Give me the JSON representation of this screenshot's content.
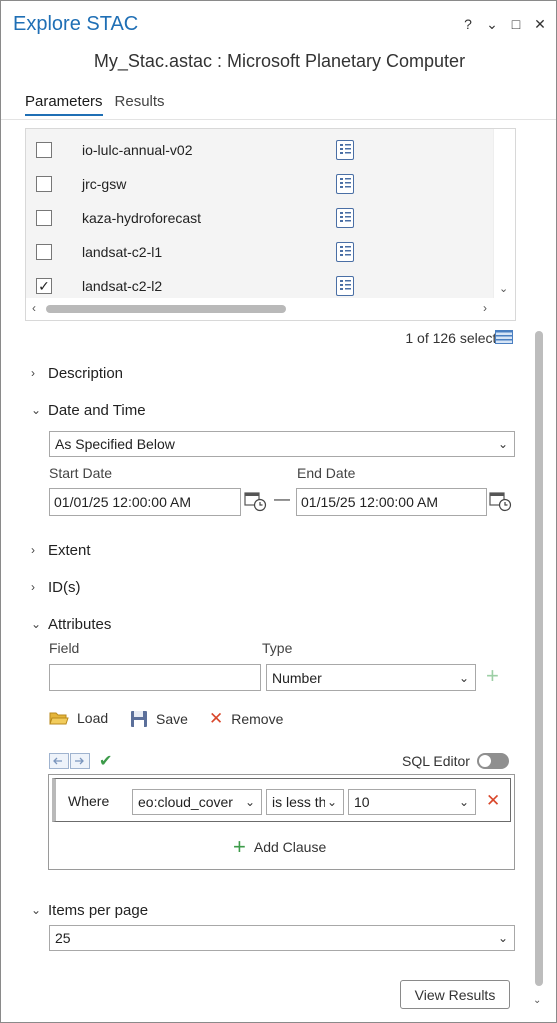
{
  "window": {
    "title": "Explore STAC",
    "controls": [
      "?",
      "⌄",
      "□",
      "✕"
    ]
  },
  "subtitle": "My_Stac.astac : Microsoft Planetary Computer",
  "tabs": [
    {
      "label": "Parameters",
      "active": true
    },
    {
      "label": "Results",
      "active": false
    }
  ],
  "collections": {
    "items": [
      {
        "label": "io-lulc-annual-v02",
        "checked": false
      },
      {
        "label": "jrc-gsw",
        "checked": false
      },
      {
        "label": "kaza-hydroforecast",
        "checked": false
      },
      {
        "label": "landsat-c2-l1",
        "checked": false
      },
      {
        "label": "landsat-c2-l2",
        "checked": true
      }
    ],
    "selected_text": "1 of 126 selected"
  },
  "sections": {
    "description": "Description",
    "date_time": "Date and Time",
    "extent": "Extent",
    "ids": "ID(s)",
    "attributes": "Attributes",
    "items_per_page": "Items per page"
  },
  "date_time": {
    "mode": "As Specified Below",
    "start_label": "Start Date",
    "start_value": "01/01/25 12:00:00 AM",
    "dash": "—",
    "end_label": "End Date",
    "end_value": "01/15/25 12:00:00 AM"
  },
  "attributes": {
    "field_label": "Field",
    "field_value": "",
    "type_label": "Type",
    "type_value": "Number",
    "add_icon": "+",
    "load_label": "Load",
    "save_label": "Save",
    "remove_label": "Remove",
    "sql_editor_label": "SQL Editor",
    "sql_editor_on": false,
    "clause": {
      "where_label": "Where",
      "field": "eo:cloud_cover",
      "operator": "is less th",
      "value": "10"
    },
    "add_clause_label": "Add Clause"
  },
  "items_per_page": {
    "value": "25"
  },
  "view_results_label": "View Results",
  "colors": {
    "accent": "#1f6fb5",
    "remove_red": "#d9472b",
    "add_green": "#3d9b4a",
    "folder_yellow": "#e5b53a"
  }
}
